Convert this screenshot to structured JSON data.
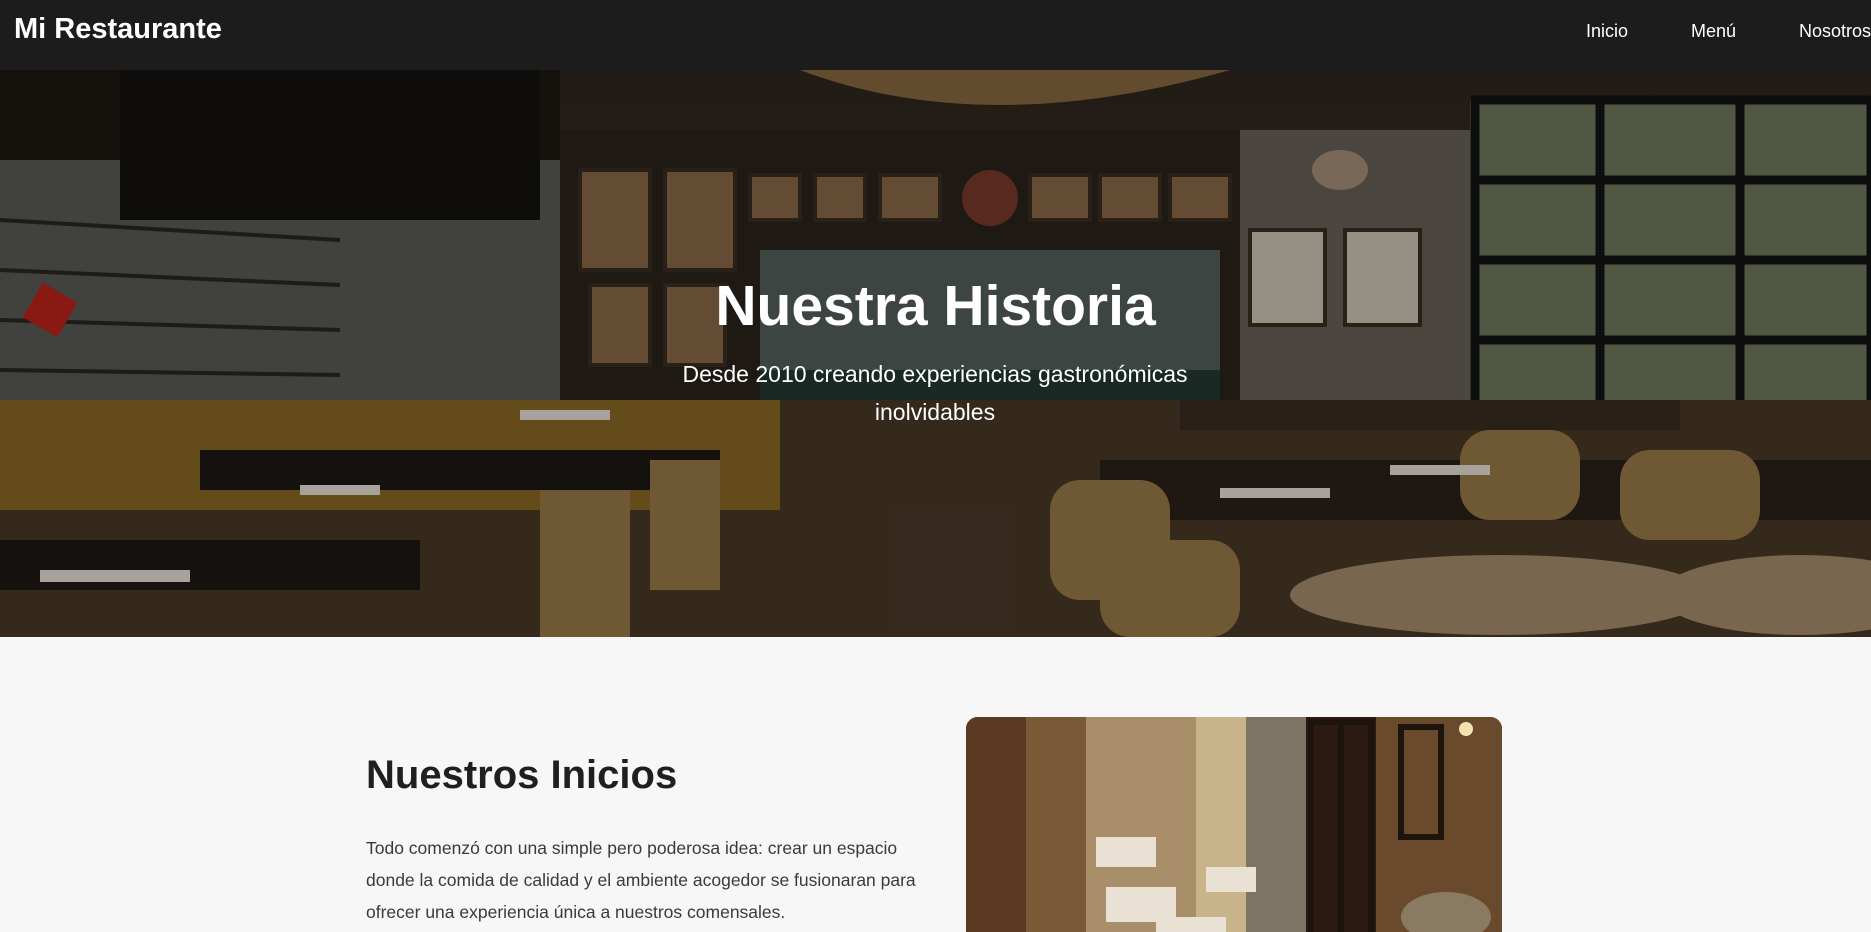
{
  "navbar": {
    "brand": "Mi Restaurante",
    "links": [
      "Inicio",
      "Menú",
      "Nosotros"
    ]
  },
  "hero": {
    "title": "Nuestra Historia",
    "subtitle": "Desde 2010 creando experiencias gastronómicas inolvidables"
  },
  "story": {
    "title": "Nuestros Inicios",
    "paragraph": "Todo comenzó con una simple pero poderosa idea: crear un espacio donde la comida de calidad y el ambiente acogedor se fusionaran para ofrecer una experiencia única a nuestros comensales."
  },
  "colors": {
    "navbar_bg": "#1c1c1c",
    "page_bg": "#f7f7f7",
    "text_dark": "#1f1f1f",
    "hero_text": "#ffffff"
  }
}
